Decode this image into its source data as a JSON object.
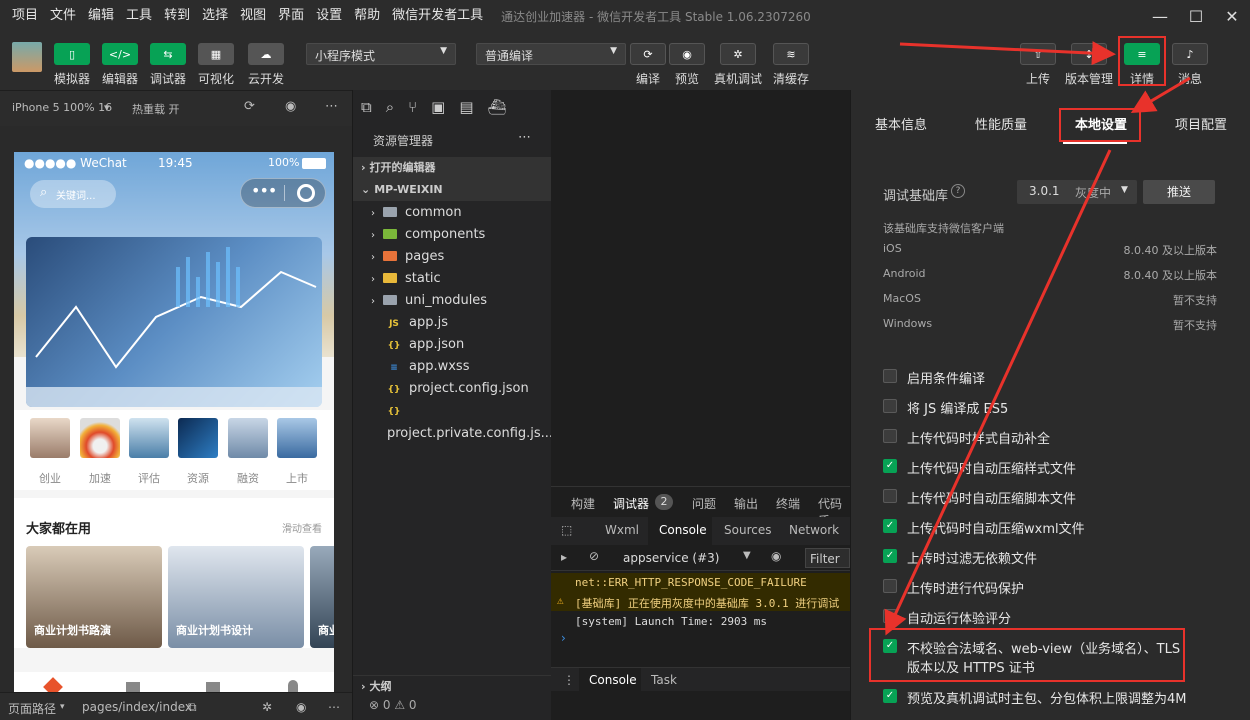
{
  "menu": [
    "项目",
    "文件",
    "编辑",
    "工具",
    "转到",
    "选择",
    "视图",
    "界面",
    "设置",
    "帮助",
    "微信开发者工具"
  ],
  "app_title": "通达创业加速器 - 微信开发者工具 Stable 1.06.2307260",
  "toolbar": {
    "left": [
      {
        "label": "模拟器",
        "glyph": "▯"
      },
      {
        "label": "编辑器",
        "glyph": "</>"
      },
      {
        "label": "调试器",
        "glyph": "⇆"
      },
      {
        "label": "可视化",
        "glyph": "▦"
      },
      {
        "label": "云开发",
        "glyph": "☁"
      }
    ],
    "mode_select": "小程序模式",
    "compile_select": "普通编译",
    "mid": [
      {
        "label": "编译",
        "glyph": "⟳"
      },
      {
        "label": "预览",
        "glyph": "◉"
      },
      {
        "label": "真机调试",
        "glyph": "✲"
      },
      {
        "label": "清缓存",
        "glyph": "≋"
      }
    ],
    "right": [
      {
        "label": "上传",
        "glyph": "⇧"
      },
      {
        "label": "版本管理",
        "glyph": "↕"
      },
      {
        "label": "详情",
        "glyph": "≡"
      },
      {
        "label": "消息",
        "glyph": "🔔"
      }
    ]
  },
  "simulator": {
    "device": "iPhone 5 100% 16",
    "hot_reload": "热重载 开",
    "status_carrier": "●●●●● WeChat",
    "status_time": "19:45",
    "status_battery": "100%",
    "search_placeholder": "关键词...",
    "icons": [
      "创业",
      "加速",
      "评估",
      "资源",
      "融资",
      "上市"
    ],
    "section_title": "大家都在用",
    "section_more": "滑动查看",
    "cards": [
      "商业计划书路演",
      "商业计划书设计",
      "商业"
    ],
    "footer_path_label": "页面路径",
    "footer_path": "pages/index/index"
  },
  "explorer": {
    "title": "资源管理器",
    "open_editors": "打开的编辑器",
    "project": "MP-WEIXIN",
    "folders": [
      "common",
      "components",
      "pages",
      "static",
      "uni_modules"
    ],
    "files": [
      {
        "name": "app.js",
        "tag": "JS",
        "color": "#e8c339"
      },
      {
        "name": "app.json",
        "tag": "{}",
        "color": "#e8c339"
      },
      {
        "name": "app.wxss",
        "tag": "≡",
        "color": "#3d8fe0"
      },
      {
        "name": "project.config.json",
        "tag": "{}",
        "color": "#e8c339"
      },
      {
        "name": "project.private.config.js...",
        "tag": "{}",
        "color": "#e8c339"
      }
    ],
    "outline": "大纲",
    "status": "⊗ 0 ⚠ 0"
  },
  "console": {
    "tabs": [
      "构建",
      "调试器",
      "问题",
      "输出",
      "终端",
      "代码质"
    ],
    "debugger_badge": "2",
    "subtabs": [
      "Wxml",
      "Console",
      "Sources",
      "Network"
    ],
    "context": "appservice (#3)",
    "filter": "Filter",
    "lines": [
      "net::ERR_HTTP_RESPONSE_CODE_FAILURE",
      "[基础库] 正在使用灰度中的基础库 3.0.1 进行调试",
      "[system] Launch Time: 2903 ms"
    ],
    "bottom_tabs": [
      "Console",
      "Task"
    ]
  },
  "details": {
    "tabs": [
      "基本信息",
      "性能质量",
      "本地设置",
      "项目配置"
    ],
    "lib_label": "调试基础库",
    "lib_version": "3.0.1",
    "lib_state": "灰度中",
    "push_button": "推送",
    "support_note": "该基础库支持微信客户端",
    "platforms": [
      {
        "name": "iOS",
        "value": "8.0.40 及以上版本"
      },
      {
        "name": "Android",
        "value": "8.0.40 及以上版本"
      },
      {
        "name": "MacOS",
        "value": "暂不支持"
      },
      {
        "name": "Windows",
        "value": "暂不支持"
      }
    ],
    "options": [
      {
        "label": "启用条件编译",
        "checked": false
      },
      {
        "label": "将 JS 编译成 ES5",
        "checked": false
      },
      {
        "label": "上传代码时样式自动补全",
        "checked": false
      },
      {
        "label": "上传代码时自动压缩样式文件",
        "checked": true
      },
      {
        "label": "上传代码时自动压缩脚本文件",
        "checked": false
      },
      {
        "label": "上传代码时自动压缩wxml文件",
        "checked": true
      },
      {
        "label": "上传时过滤无依赖文件",
        "checked": true
      },
      {
        "label": "上传时进行代码保护",
        "checked": false
      },
      {
        "label": "自动运行体验评分",
        "checked": false
      }
    ],
    "highlight_option_line1": "不校验合法域名、web-view（业务域名）、TLS",
    "highlight_option_line2": "版本以及 HTTPS 证书",
    "last_option": "预览及真机调试时主包、分包体积上限调整为4M"
  }
}
